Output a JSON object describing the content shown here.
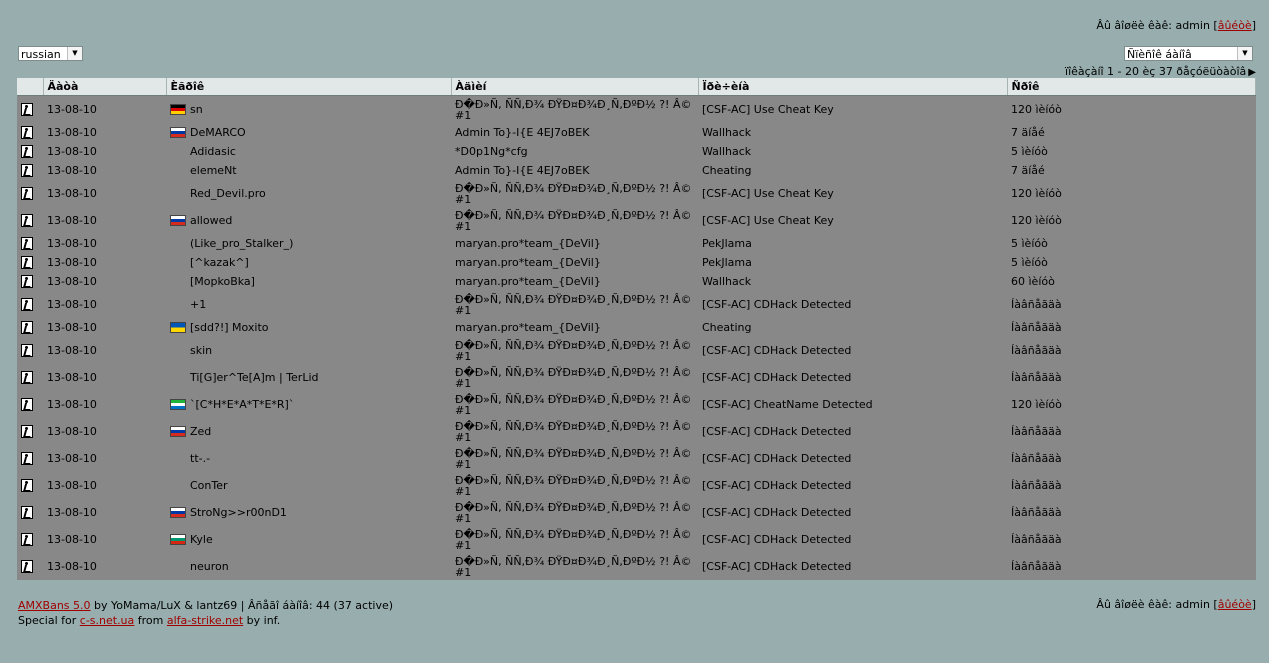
{
  "header": {
    "logged_in_text": "Âû âîøëè êàê: admin [",
    "logout_label": "âûéòè",
    "bracket_close": "]"
  },
  "language_select": {
    "value": "russian"
  },
  "list_select": {
    "value": "Ñïèñîê áàíîâ"
  },
  "pager": {
    "text": "ïîêàçàíî 1 - 20 èç 37 ðåçóëüòàòîâ",
    "next": "▶"
  },
  "columns": [
    "Äàòà",
    "Èãðîê",
    "Àäìèí",
    "Ïðè÷èíà",
    "Ñðîê"
  ],
  "flag_colors": {
    "de": [
      "#000000",
      "#dd0000",
      "#ffce00"
    ],
    "ru": [
      "#ffffff",
      "#0039a6",
      "#d52b1e"
    ],
    "ua": [
      "#0057b7",
      "#ffd700"
    ],
    "sl": [
      "#1eb53a",
      "#ffffff",
      "#0072c6"
    ],
    "bg": [
      "#ffffff",
      "#00966e",
      "#d62612"
    ]
  },
  "rows": [
    {
      "date": "13-08-10",
      "flag": "de",
      "player": "sn",
      "admin": "Ð�Ð»Ñ, ÑÑ‚Ð¾ ÐŸÐ¤Ð¾Ð¸Ñ,ÐºÐ½ ?! Â© #1",
      "reason": "[CSF-AC] Use Cheat Key",
      "term": "120 ìèíóò"
    },
    {
      "date": "13-08-10",
      "flag": "ru",
      "player": "DeMARCO",
      "admin": "Admin To}-I{E 4EJ7oBEK",
      "reason": "Wallhack",
      "term": "7 äíåé"
    },
    {
      "date": "13-08-10",
      "flag": "",
      "player": "Adidasic",
      "admin": "*D0p1Ng*cfg",
      "reason": "Wallhack",
      "term": "5 ìèíóò"
    },
    {
      "date": "13-08-10",
      "flag": "",
      "player": "elemeNt",
      "admin": "Admin To}-I{E 4EJ7oBEK",
      "reason": "Cheating",
      "term": "7 äíåé"
    },
    {
      "date": "13-08-10",
      "flag": "",
      "player": "Red_Devil.pro",
      "admin": "Ð�Ð»Ñ, ÑÑ‚Ð¾ ÐŸÐ¤Ð¾Ð¸Ñ,ÐºÐ½ ?! Â© #1",
      "reason": "[CSF-AC] Use Cheat Key",
      "term": "120 ìèíóò"
    },
    {
      "date": "13-08-10",
      "flag": "ru",
      "player": "allowed",
      "admin": "Ð�Ð»Ñ, ÑÑ‚Ð¾ ÐŸÐ¤Ð¾Ð¸Ñ,ÐºÐ½ ?! Â© #1",
      "reason": "[CSF-AC] Use Cheat Key",
      "term": "120 ìèíóò"
    },
    {
      "date": "13-08-10",
      "flag": "",
      "player": "(Like_pro_Stalker_)",
      "admin": "maryan.pro*team_{DeVil}",
      "reason": "PekJlama",
      "term": "5 ìèíóò"
    },
    {
      "date": "13-08-10",
      "flag": "",
      "player": "[^kazak^]",
      "admin": "maryan.pro*team_{DeVil}",
      "reason": "PekJlama",
      "term": "5 ìèíóò"
    },
    {
      "date": "13-08-10",
      "flag": "",
      "player": "[MopkoBka]",
      "admin": "maryan.pro*team_{DeVil}",
      "reason": "Wallhack",
      "term": "60 ìèíóò"
    },
    {
      "date": "13-08-10",
      "flag": "",
      "player": "+1",
      "admin": "Ð�Ð»Ñ, ÑÑ‚Ð¾ ÐŸÐ¤Ð¾Ð¸Ñ,ÐºÐ½ ?! Â© #1",
      "reason": "[CSF-AC] CDHack Detected",
      "term": "Íàâñåãäà"
    },
    {
      "date": "13-08-10",
      "flag": "ua",
      "player": "[sdd?!] Moxito",
      "admin": "maryan.pro*team_{DeVil}",
      "reason": "Cheating",
      "term": "Íàâñåãäà"
    },
    {
      "date": "13-08-10",
      "flag": "",
      "player": "skin",
      "admin": "Ð�Ð»Ñ, ÑÑ‚Ð¾ ÐŸÐ¤Ð¾Ð¸Ñ,ÐºÐ½ ?! Â© #1",
      "reason": "[CSF-AC] CDHack Detected",
      "term": "Íàâñåãäà"
    },
    {
      "date": "13-08-10",
      "flag": "",
      "player": "Ti[G]er^Te[A]m | TerLid",
      "admin": "Ð�Ð»Ñ, ÑÑ‚Ð¾ ÐŸÐ¤Ð¾Ð¸Ñ,ÐºÐ½ ?! Â© #1",
      "reason": "[CSF-AC] CDHack Detected",
      "term": "Íàâñåãäà"
    },
    {
      "date": "13-08-10",
      "flag": "sl",
      "player": "`[C*H*E*A*T*E*R]`",
      "admin": "Ð�Ð»Ñ, ÑÑ‚Ð¾ ÐŸÐ¤Ð¾Ð¸Ñ,ÐºÐ½ ?! Â© #1",
      "reason": "[CSF-AC] CheatName Detected",
      "term": "120 ìèíóò"
    },
    {
      "date": "13-08-10",
      "flag": "ru",
      "player": "Zed",
      "admin": "Ð�Ð»Ñ, ÑÑ‚Ð¾ ÐŸÐ¤Ð¾Ð¸Ñ,ÐºÐ½ ?! Â© #1",
      "reason": "[CSF-AC] CDHack Detected",
      "term": "Íàâñåãäà"
    },
    {
      "date": "13-08-10",
      "flag": "",
      "player": "tt-.-",
      "admin": "Ð�Ð»Ñ, ÑÑ‚Ð¾ ÐŸÐ¤Ð¾Ð¸Ñ,ÐºÐ½ ?! Â© #1",
      "reason": "[CSF-AC] CDHack Detected",
      "term": "Íàâñåãäà"
    },
    {
      "date": "13-08-10",
      "flag": "",
      "player": "ConTer",
      "admin": "Ð�Ð»Ñ, ÑÑ‚Ð¾ ÐŸÐ¤Ð¾Ð¸Ñ,ÐºÐ½ ?! Â© #1",
      "reason": "[CSF-AC] CDHack Detected",
      "term": "Íàâñåãäà"
    },
    {
      "date": "13-08-10",
      "flag": "ru",
      "player": "StroNg>>r00nD1",
      "admin": "Ð�Ð»Ñ, ÑÑ‚Ð¾ ÐŸÐ¤Ð¾Ð¸Ñ,ÐºÐ½ ?! Â© #1",
      "reason": "[CSF-AC] CDHack Detected",
      "term": "Íàâñåãäà"
    },
    {
      "date": "13-08-10",
      "flag": "bg",
      "player": "Kyle",
      "admin": "Ð�Ð»Ñ, ÑÑ‚Ð¾ ÐŸÐ¤Ð¾Ð¸Ñ,ÐºÐ½ ?! Â© #1",
      "reason": "[CSF-AC] CDHack Detected",
      "term": "Íàâñåãäà"
    },
    {
      "date": "13-08-10",
      "flag": "",
      "player": "neuron",
      "admin": "Ð�Ð»Ñ, ÑÑ‚Ð¾ ÐŸÐ¤Ð¾Ð¸Ñ,ÐºÐ½ ?! Â© #1",
      "reason": "[CSF-AC] CDHack Detected",
      "term": "Íàâñåãäà"
    }
  ],
  "footer": {
    "amxbans_link": "AMXBans 5.0",
    "credits": " by YoMama/LuX & lantz69 | Âñåãî áàíîâ: 44 (37 active)",
    "special_for": "Special for ",
    "site1": "c-s.net.ua",
    "from": " from ",
    "site2": "alfa-strike.net",
    "by": " by inf.",
    "logged_in_text": "Âû âîøëè êàê: admin [",
    "logout_label": "âûéòè",
    "bracket_close": "]"
  }
}
